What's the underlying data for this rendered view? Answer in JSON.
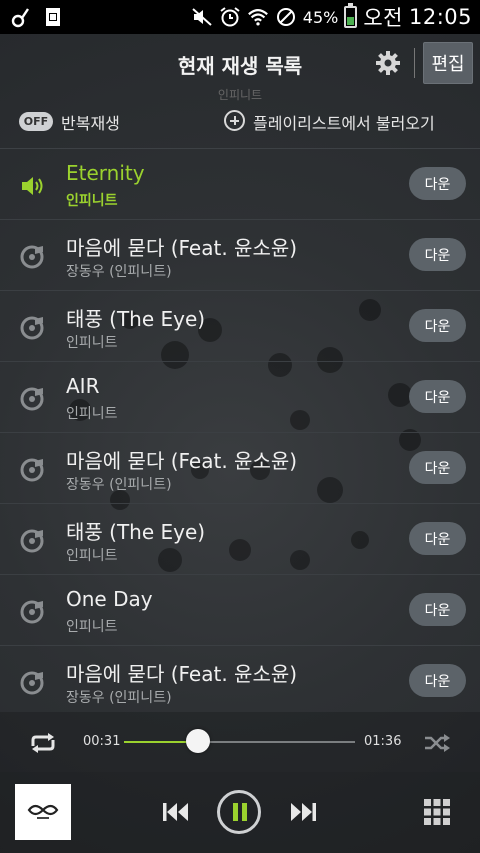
{
  "status_bar": {
    "battery_percent": "45%",
    "battery_level": 0.45,
    "ampm": "오전",
    "time": "12:05"
  },
  "header": {
    "title": "현재 재생 목록",
    "edit_label": "편집",
    "ghost_text": "인피니트"
  },
  "options": {
    "repeat_state": "OFF",
    "repeat_label": "반복재생",
    "load_playlist_label": "플레이리스트에서 불러오기"
  },
  "tracks": [
    {
      "title": "Eternity",
      "artist": "인피니트",
      "download": "다운",
      "active": true
    },
    {
      "title": "마음에 묻다 (Feat. 윤소윤)",
      "artist": "장동우 (인피니트)",
      "download": "다운"
    },
    {
      "title": "태풍 (The Eye)",
      "artist": "인피니트",
      "download": "다운"
    },
    {
      "title": "AIR",
      "artist": "인피니트",
      "download": "다운"
    },
    {
      "title": "마음에 묻다 (Feat. 윤소윤)",
      "artist": "장동우 (인피니트)",
      "download": "다운"
    },
    {
      "title": "태풍 (The Eye)",
      "artist": "인피니트",
      "download": "다운"
    },
    {
      "title": "One Day",
      "artist": "인피니트",
      "download": "다운"
    },
    {
      "title": "마음에 묻다 (Feat. 윤소윤)",
      "artist": "장동우 (인피니트)",
      "download": "다운"
    }
  ],
  "player": {
    "current_time": "00:31",
    "total_time": "01:36",
    "progress": 0.32
  },
  "colors": {
    "accent": "#9bd22e",
    "background": "#2b2f33",
    "button": "#5c6369"
  }
}
